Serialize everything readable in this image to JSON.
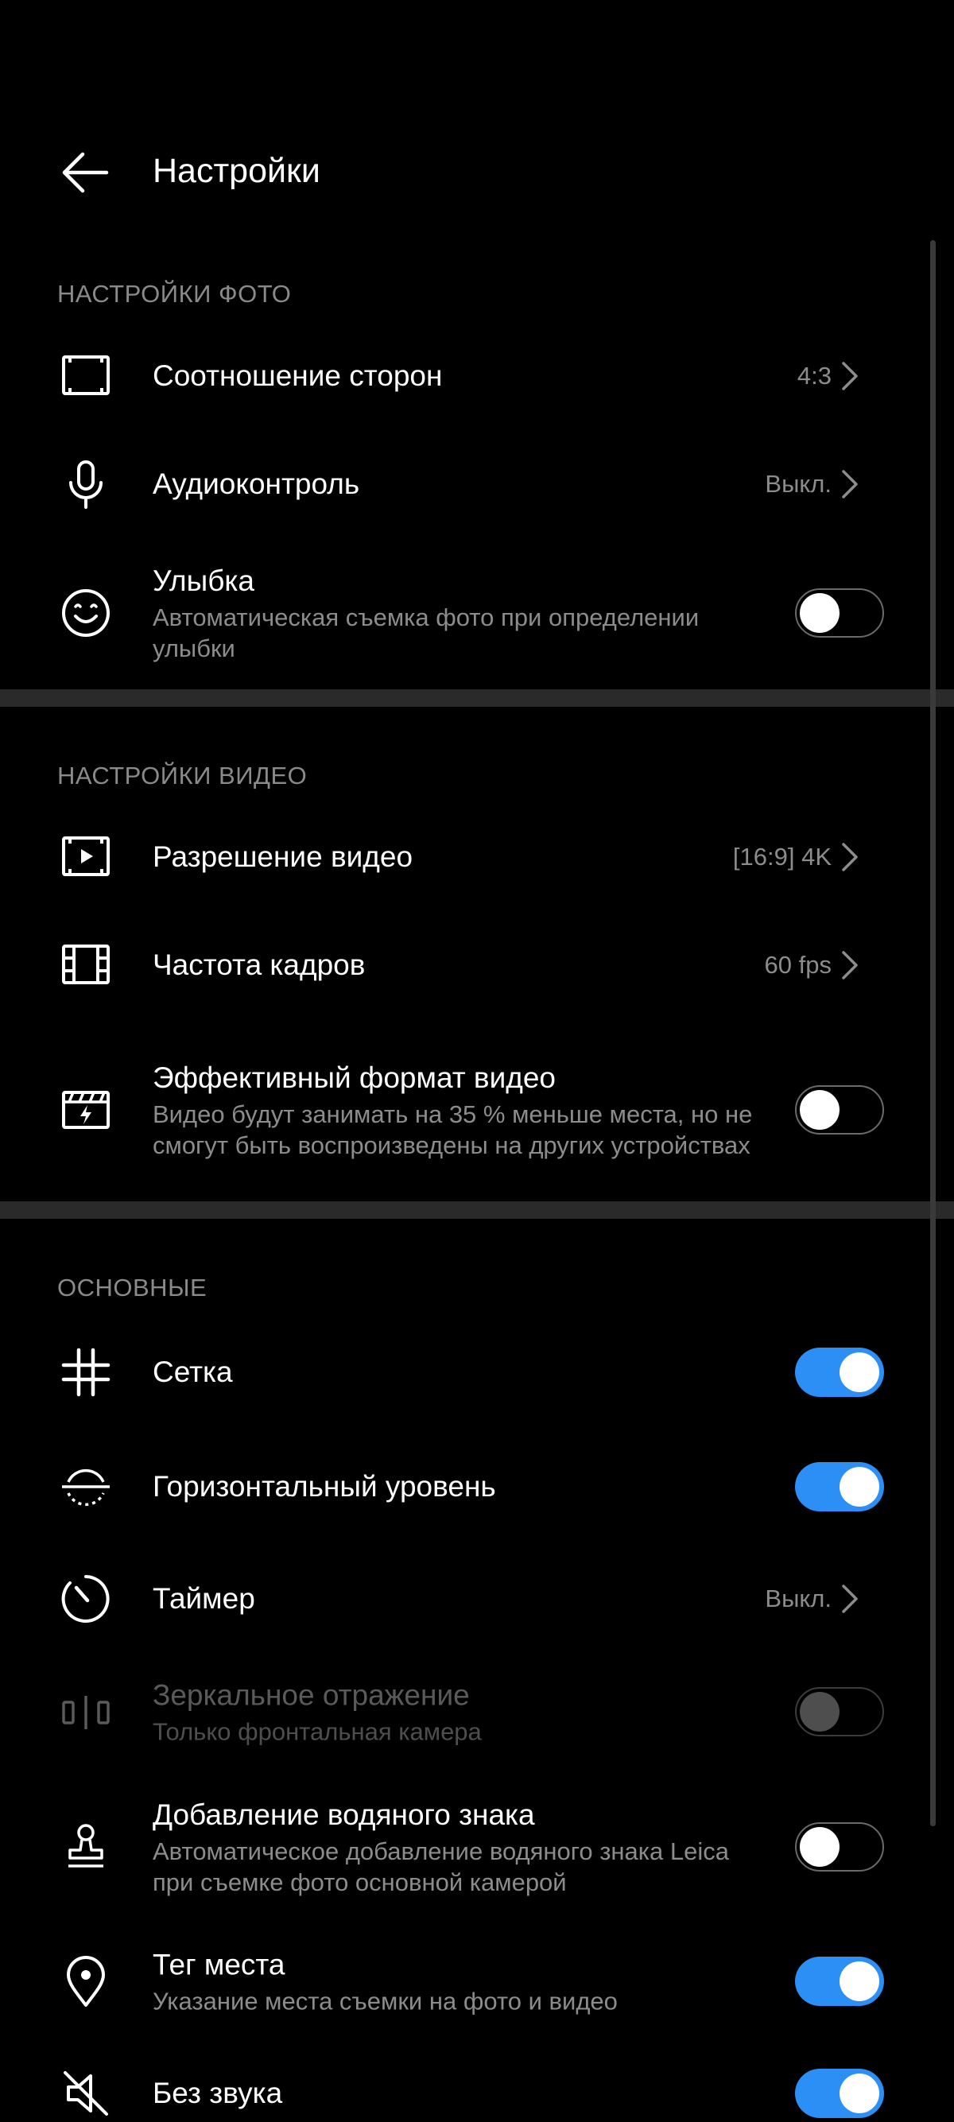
{
  "header": {
    "title": "Настройки",
    "back_icon": "arrow-left-icon"
  },
  "sections": [
    {
      "title": "НАСТРОЙКИ ФОТО",
      "items": [
        {
          "icon": "aspect-ratio-icon",
          "label": "Соотношение сторон",
          "value": "4:3",
          "control": "chevron"
        },
        {
          "icon": "microphone-icon",
          "label": "Аудиоконтроль",
          "value": "Выкл.",
          "control": "chevron"
        },
        {
          "icon": "smile-icon",
          "label": "Улыбка",
          "sub": "Автоматическая съемка фото при определении улыбки",
          "control": "toggle",
          "on": false
        }
      ]
    },
    {
      "title": "НАСТРОЙКИ ВИДЕО",
      "items": [
        {
          "icon": "video-resolution-icon",
          "label": "Разрешение видео",
          "value": "[16:9] 4K",
          "control": "chevron"
        },
        {
          "icon": "film-icon",
          "label": "Частота кадров",
          "value": "60 fps",
          "control": "chevron"
        },
        {
          "icon": "efficient-video-icon",
          "label": "Эффективный формат видео",
          "sub": "Видео будут занимать на 35 % меньше места, но не смогут быть воспроизведены на других устройствах",
          "control": "toggle",
          "on": false
        }
      ]
    },
    {
      "title": "ОСНОВНЫЕ",
      "items": [
        {
          "icon": "grid-icon",
          "label": "Сетка",
          "control": "toggle",
          "on": true
        },
        {
          "icon": "horizontal-level-icon",
          "label": "Горизонтальный уровень",
          "control": "toggle",
          "on": true
        },
        {
          "icon": "timer-icon",
          "label": "Таймер",
          "value": "Выкл.",
          "control": "chevron"
        },
        {
          "icon": "mirror-icon",
          "label": "Зеркальное отражение",
          "sub": "Только фронтальная камера",
          "control": "toggle",
          "on": false,
          "disabled": true
        },
        {
          "icon": "watermark-stamp-icon",
          "label": "Добавление водяного знака",
          "sub": "Автоматическое добавление водяного знака Leica при съемке фото основной камерой",
          "control": "toggle",
          "on": false
        },
        {
          "icon": "location-pin-icon",
          "label": "Тег места",
          "sub": "Указание места съемки на фото и видео",
          "control": "toggle",
          "on": true
        },
        {
          "icon": "mute-icon",
          "label": "Без звука",
          "control": "toggle",
          "on": true
        }
      ]
    }
  ],
  "colors": {
    "background": "#000000",
    "accent": "#2b8ff5",
    "section_title": "#8a8a8a",
    "divider": "#2a2a2a"
  }
}
